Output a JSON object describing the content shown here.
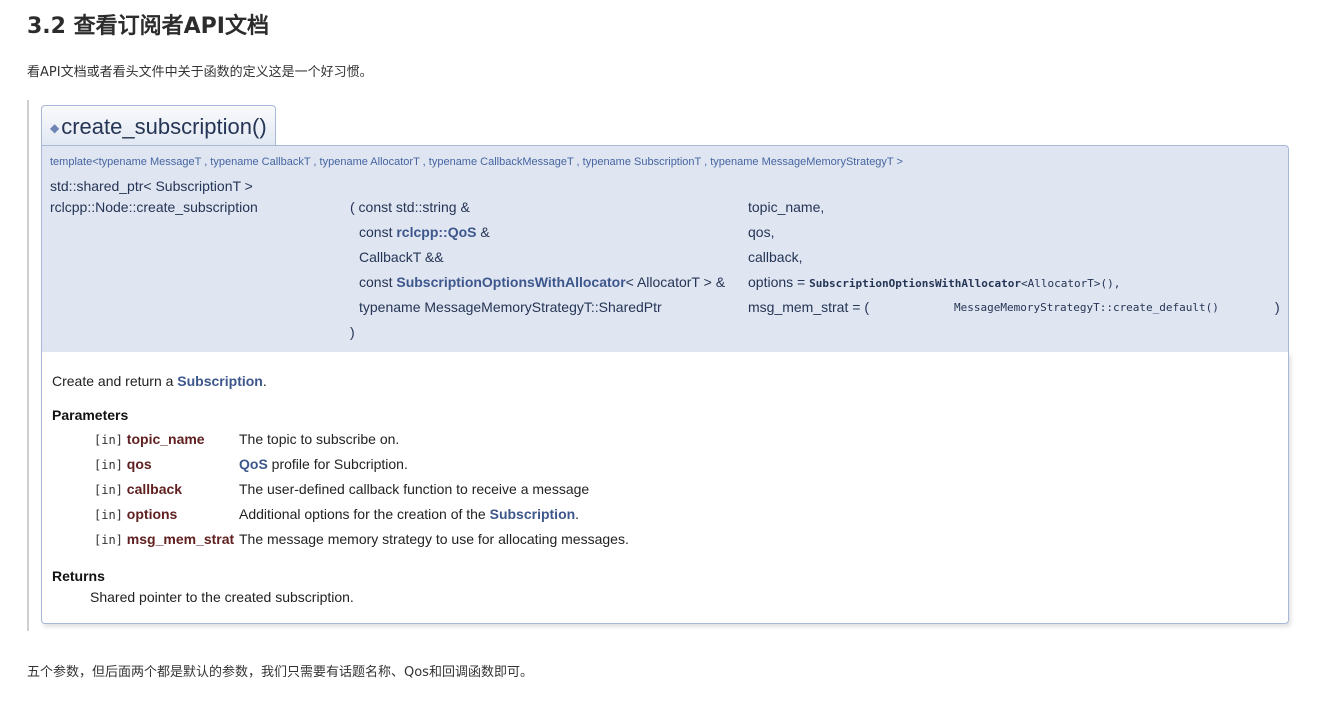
{
  "section": {
    "heading": "3.2 查看订阅者API文档",
    "intro": "看API文档或者看头文件中关于函数的定义这是一个好习惯。",
    "outro": "五个参数，但后面两个都是默认的参数，我们只需要有话题名称、Qos和回调函数即可。"
  },
  "member": {
    "bullet": "◆",
    "title": "create_subscription()",
    "template": "template<typename MessageT , typename CallbackT , typename AllocatorT , typename CallbackMessageT , typename SubscriptionT , typename MessageMemoryStrategyT >",
    "return_type": "std::shared_ptr< SubscriptionT >",
    "func_name": "rclcpp::Node::create_subscription",
    "close_paren": ")",
    "params": [
      {
        "pre": "( const std::string &",
        "link": "",
        "post": "",
        "name": "topic_name,"
      },
      {
        "pre": "const ",
        "link": "rclcpp::QoS",
        "post": " &",
        "name": "qos,"
      },
      {
        "pre": "CallbackT &&",
        "link": "",
        "post": "",
        "name": "callback,"
      },
      {
        "pre": "const ",
        "link": "SubscriptionOptionsWithAllocator",
        "post": "< AllocatorT > &",
        "name": "options = "
      },
      {
        "pre": "typename MessageMemoryStrategyT::SharedPtr",
        "link": "",
        "post": "",
        "name": "msg_mem_strat = ("
      }
    ],
    "options_default_bold": "SubscriptionOptionsWithAllocator",
    "options_default_rest": "<AllocatorT>(),",
    "msg_default": "MessageMemoryStrategyT::create_default()",
    "msg_default_close": ")"
  },
  "doc": {
    "brief_pre": "Create and return a ",
    "brief_link": "Subscription",
    "brief_post": ".",
    "params_title": "Parameters",
    "params": [
      {
        "dir": "[in]",
        "name": "topic_name",
        "desc_link": "",
        "desc": "The topic to subscribe on.",
        "desc_link2": "",
        "desc_post": ""
      },
      {
        "dir": "[in]",
        "name": "qos",
        "desc_link": "QoS",
        "desc": " profile for Subcription.",
        "desc_link2": "",
        "desc_post": ""
      },
      {
        "dir": "[in]",
        "name": "callback",
        "desc_link": "",
        "desc": "The user-defined callback function to receive a message",
        "desc_link2": "",
        "desc_post": ""
      },
      {
        "dir": "[in]",
        "name": "options",
        "desc_link": "",
        "desc": "Additional options for the creation of the ",
        "desc_link2": "Subscription",
        "desc_post": "."
      },
      {
        "dir": "[in]",
        "name": "msg_mem_strat",
        "desc_link": "",
        "desc": "The message memory strategy to use for allocating messages.",
        "desc_link2": "",
        "desc_post": ""
      }
    ],
    "returns_title": "Returns",
    "returns": "Shared pointer to the created subscription."
  }
}
